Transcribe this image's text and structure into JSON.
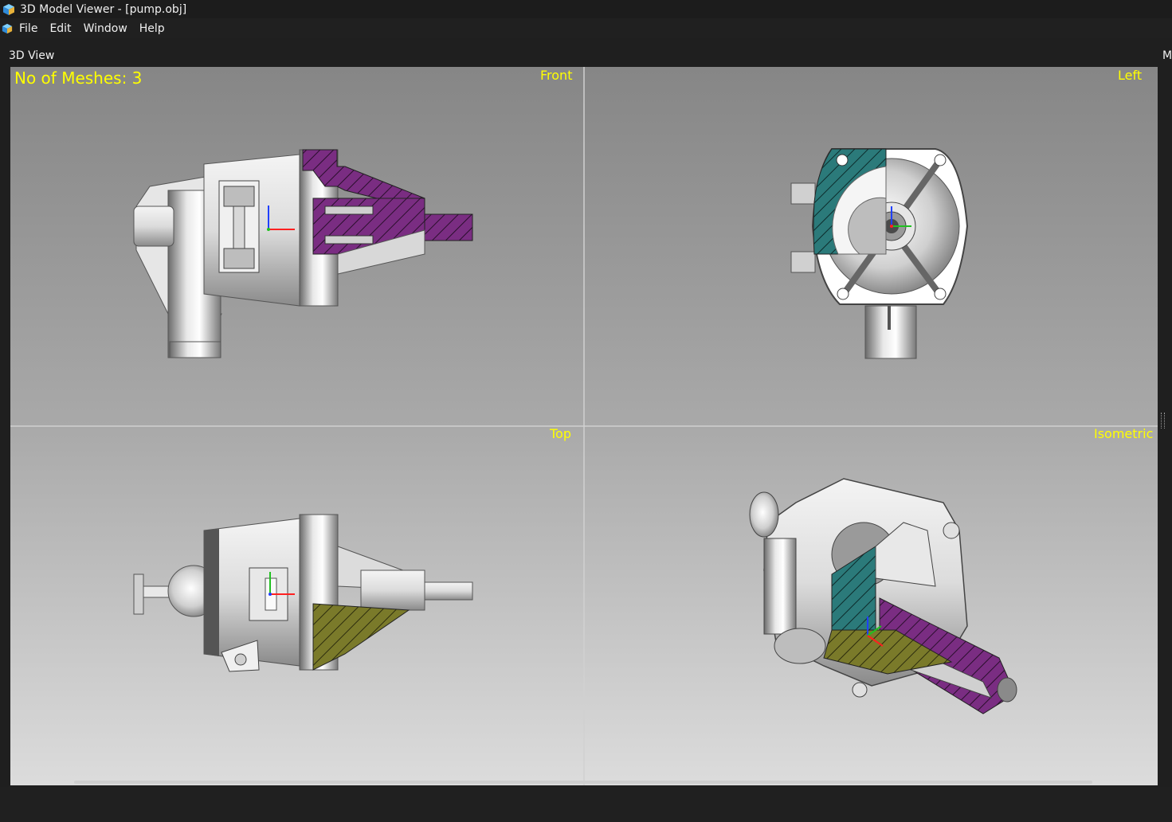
{
  "window": {
    "title": "3D Model Viewer - [pump.obj]",
    "icon": "cube-icon"
  },
  "menu": {
    "items": [
      "File",
      "Edit",
      "Window",
      "Help"
    ]
  },
  "panel": {
    "title": "3D View",
    "side_tab": "M"
  },
  "viewport": {
    "mesh_info": "No of Meshes: 3",
    "views": {
      "front": "Front",
      "left": "Left",
      "top": "Top",
      "isometric": "Isometric"
    },
    "axes": {
      "x": "x",
      "y": "y",
      "z": "z"
    }
  },
  "colors": {
    "label_yellow": "#ffff00",
    "section_purple": "#7a2d82",
    "section_teal": "#2b7a7a",
    "section_olive": "#7a7a2a",
    "axis_x": "#ff2020",
    "axis_y": "#20c020",
    "axis_z": "#2040ff"
  }
}
